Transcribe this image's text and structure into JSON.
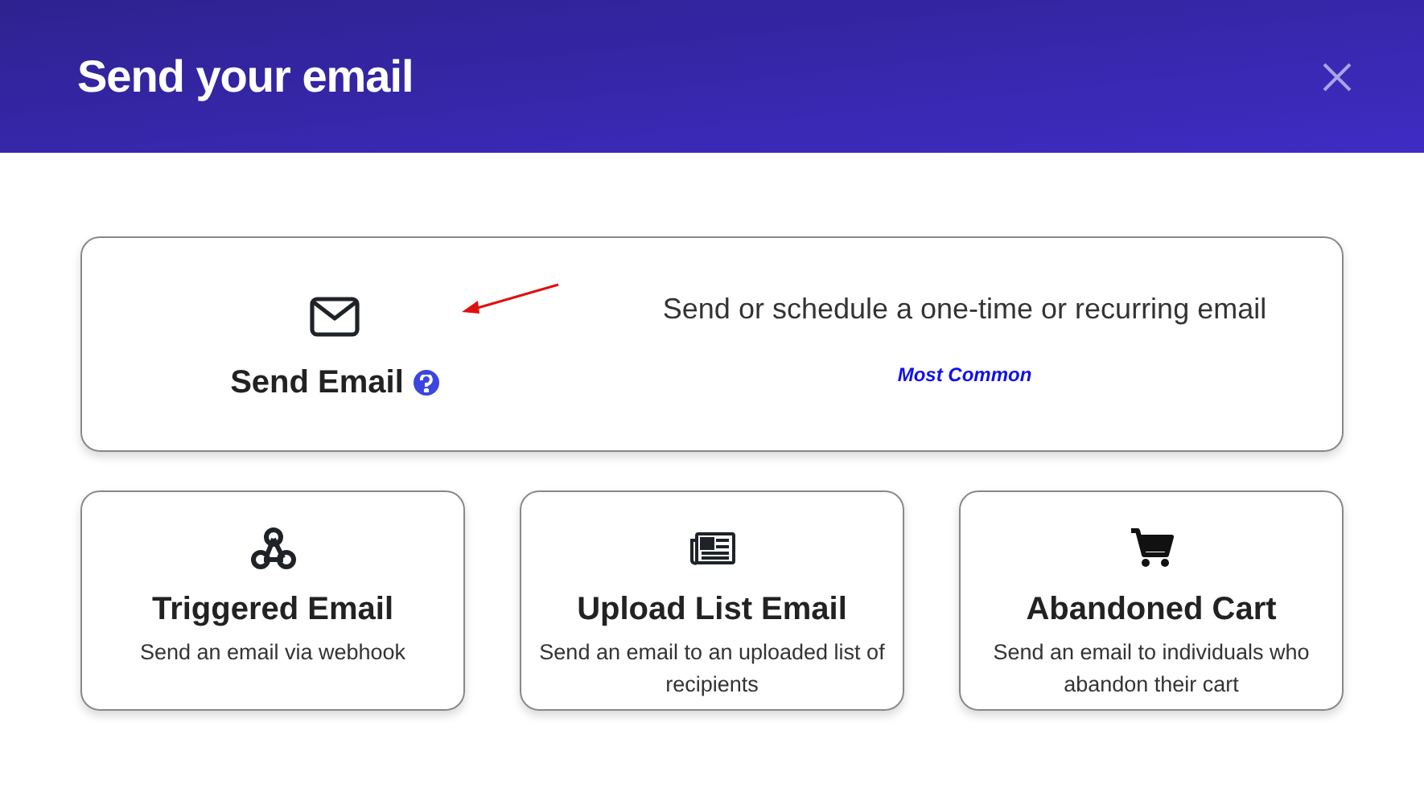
{
  "dialog": {
    "title": "Send your email"
  },
  "featured": {
    "title": "Send Email",
    "description": "Send or schedule a one-time or recurring email",
    "badge": "Most Common"
  },
  "options": [
    {
      "kind": "webhook",
      "title": "Triggered Email",
      "description": "Send an email via webhook"
    },
    {
      "kind": "newspaper",
      "title": "Upload List Email",
      "description": "Send an email to an uploaded list of recipients"
    },
    {
      "kind": "cart",
      "title": "Abandoned Cart",
      "description": "Send an email to individuals who abandon their cart"
    }
  ]
}
